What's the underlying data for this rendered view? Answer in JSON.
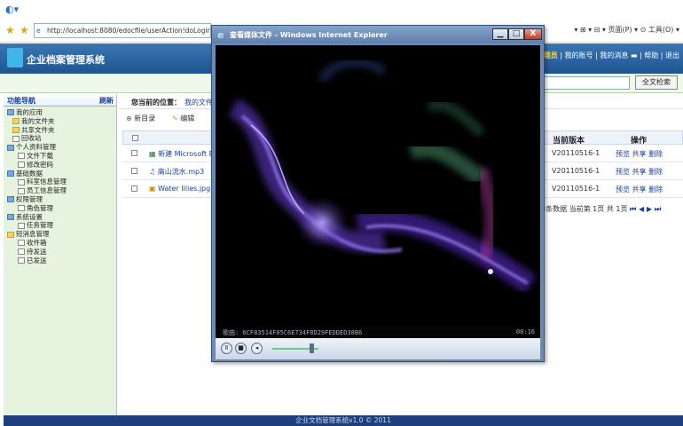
{
  "browser": {
    "address": "http://localhost:8080/edocfile/userAction!doLogin.act...",
    "tools_text": "▾ ⊞ ▾ ⊟ ▾ 页面(P) ▾ ⊙ 工具(O) ▾"
  },
  "app": {
    "title": "企业档案管理系统",
    "role": "管理员",
    "links": "| 我的账号 | 我的消息 ▬ | 帮助 | 退出",
    "search_button": "全文检索"
  },
  "sidebar": {
    "title": "功能导航",
    "refresh": "刷新",
    "items": [
      {
        "label": "我的应用"
      },
      {
        "label": "我的文件夹"
      },
      {
        "label": "共享文件夹"
      },
      {
        "label": "回收站"
      },
      {
        "label": "个人资料管理"
      },
      {
        "label": "文件下载"
      },
      {
        "label": "修改密码"
      },
      {
        "label": "基础数据"
      },
      {
        "label": "科室信息管理"
      },
      {
        "label": "员工信息管理"
      },
      {
        "label": "权限管理"
      },
      {
        "label": "角色管理"
      },
      {
        "label": "系统设置"
      },
      {
        "label": "任务管理"
      },
      {
        "label": "短消息管理"
      },
      {
        "label": "收件箱"
      },
      {
        "label": "待发送"
      },
      {
        "label": "已发送"
      }
    ]
  },
  "main": {
    "location_label": "您当前的位置：",
    "location_value": "我的文件夹",
    "toolbar": {
      "new_dir": "新目录",
      "edit": "编辑"
    },
    "columns": {
      "version": "当前版本",
      "ops": "操作"
    },
    "rows": [
      {
        "name": "新建 Microsoft Exc",
        "version": "V20110516-1",
        "ops": "预览  共享  删除"
      },
      {
        "name": "高山流水.mp3",
        "version": "V20110516-1",
        "ops": "预览  共享  删除"
      },
      {
        "name": "Water lilies.jpg",
        "version": "V20110516-1",
        "ops": "预览  共享  删除"
      }
    ],
    "pager": "3条数据 当前第 1页 共 1页",
    "pager_nav": "⏮ ◀ ▶ ⏭"
  },
  "footer": "企业文档管理系统v1.0 © 2011",
  "popup": {
    "title": "查看媒体文件 - Windows Internet Explorer",
    "filename": "歌曲: 6CF83514F05C6E734F8D29FEDDED38B6",
    "time": "00:16",
    "controls": {
      "play": "Ⅱ",
      "stop": "■",
      "mute": "◂"
    },
    "volume": 0.85,
    "buttons": {
      "minimize": "▁",
      "maximize": "□",
      "close": "X"
    }
  }
}
